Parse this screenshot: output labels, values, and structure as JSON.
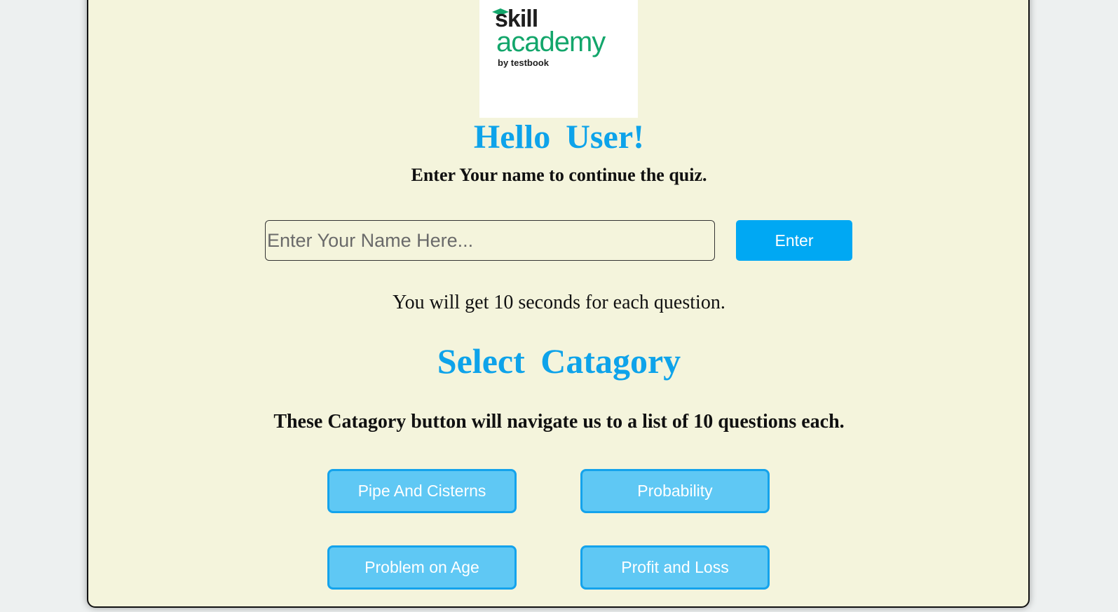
{
  "logo": {
    "line1": "skill",
    "line2": "academy",
    "line3": "by testbook"
  },
  "greeting": {
    "title": "Hello User!",
    "subtitle": "Enter Your name to continue the quiz."
  },
  "name_form": {
    "placeholder": "Enter Your Name Here...",
    "value": "",
    "submit_label": "Enter"
  },
  "timer_note": "You will get 10 seconds for each question.",
  "category_section": {
    "title": "Select Catagory",
    "description": "These Catagory button will navigate us to a list of 10 questions each.",
    "buttons": [
      {
        "label": "Pipe And Cisterns"
      },
      {
        "label": "Probability"
      },
      {
        "label": "Problem on Age"
      },
      {
        "label": "Profit and Loss"
      }
    ]
  },
  "colors": {
    "page_bg": "#f4f4dc",
    "accent_blue": "#0ea3ea",
    "button_blue": "#00a8f3",
    "category_button": "#5fc8f4",
    "logo_green": "#13a66b"
  }
}
